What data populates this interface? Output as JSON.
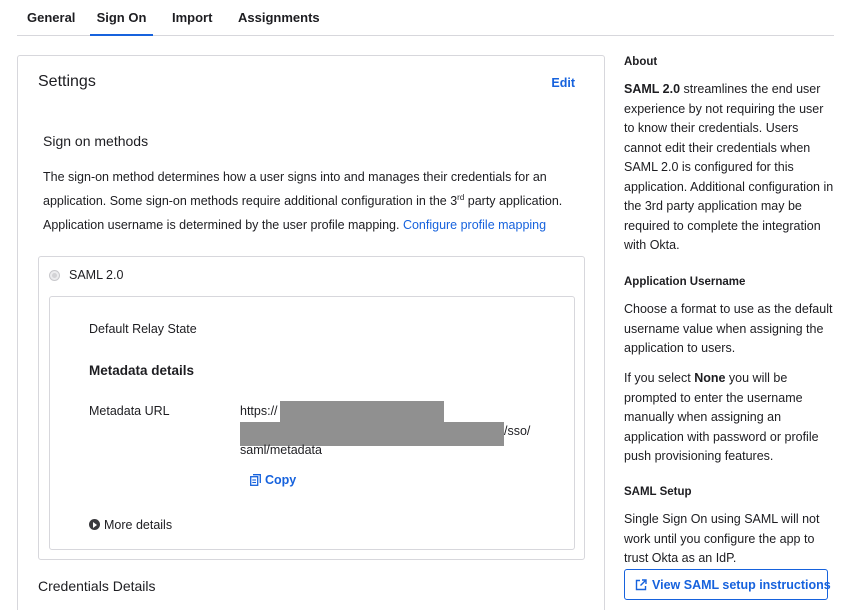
{
  "tabs": {
    "general": "General",
    "sign_on": "Sign On",
    "import": "Import",
    "assignments": "Assignments"
  },
  "settings": {
    "title": "Settings",
    "edit": "Edit",
    "sign_on_methods_title": "Sign on methods",
    "description_part1": "The sign-on method determines how a user signs into and manages their credentials for an application. Some sign-on methods require additional configuration in the 3",
    "description_sup": "rd",
    "description_part2": " party application.",
    "mapping_text": "Application username is determined by the user profile mapping.",
    "mapping_link": "Configure profile mapping",
    "method_label": "SAML 2.0",
    "relay_state_label": "Default Relay State",
    "metadata_title": "Metadata details",
    "metadata_url_label": "Metadata URL",
    "url_start": "https://",
    "url_mid": "/sso/",
    "url_end": "saml/metadata",
    "copy_label": "Copy",
    "more_details": "More details",
    "credentials_title": "Credentials Details"
  },
  "sidebar": {
    "about_title": "About",
    "about_bold": "SAML 2.0",
    "about_text": " streamlines the end user experience by not requiring the user to know their credentials. Users cannot edit their credentials when SAML 2.0 is configured for this application. Additional configuration in the 3rd party application may be required to complete the integration with Okta.",
    "username_title": "Application Username",
    "username_text": "Choose a format to use as the default username value when assigning the application to users.",
    "select_prefix": "If you select ",
    "select_bold": "None",
    "select_text": " you will be prompted to enter the username manually when assigning an application with password or profile push provisioning features.",
    "saml_setup_title": "SAML Setup",
    "saml_setup_text": "Single Sign On using SAML will not work until you configure the app to trust Okta as an IdP.",
    "saml_button": "View SAML setup instructions"
  },
  "colors": {
    "accent": "#1662dd",
    "border": "#d7d7dc",
    "redaction": "#909090"
  }
}
